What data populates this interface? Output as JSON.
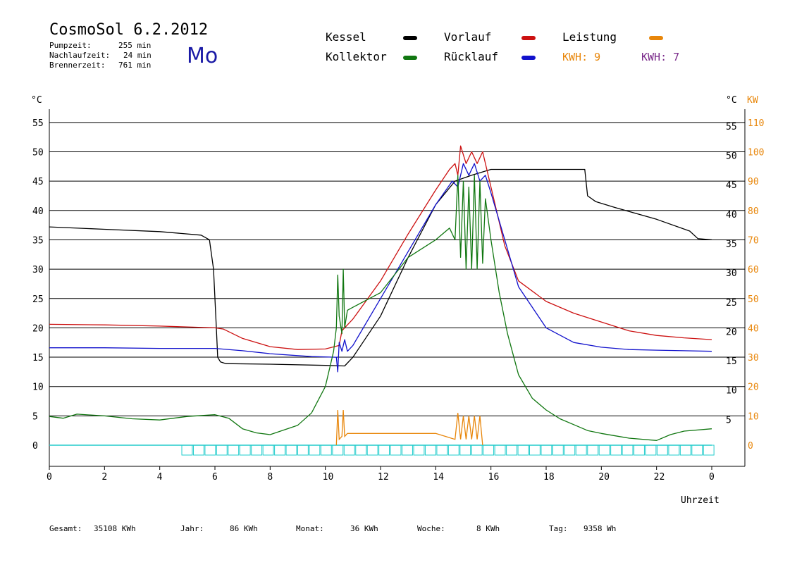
{
  "header": {
    "title": "CosmoSol 6.2.2012",
    "weekday": "Mo",
    "stats": [
      {
        "label": "Pumpzeit:",
        "value": "255 min"
      },
      {
        "label": "Nachlaufzeit:",
        "value": "24 min"
      },
      {
        "label": "Brennerzeit:",
        "value": "761 min"
      }
    ]
  },
  "legend": {
    "kessel": "Kessel",
    "kollektor": "Kollektor",
    "vorlauf": "Vorlauf",
    "ruecklauf": "Rücklauf",
    "leistung": "Leistung",
    "kwh1": "KWH: 9",
    "kwh2": "KWH: 7"
  },
  "colors": {
    "kessel": "#000000",
    "kollektor": "#117711",
    "vorlauf": "#cc1111",
    "ruecklauf": "#1111cc",
    "leistung": "#e8860a",
    "kwh2": "#7a2a8a",
    "status": "#22cccc"
  },
  "footer": {
    "gesamt_label": "Gesamt:",
    "gesamt": "35108 KWh",
    "jahr_label": "Jahr:",
    "jahr": "86 KWh",
    "monat_label": "Monat:",
    "monat": "36 KWh",
    "woche_label": "Woche:",
    "woche": "8 KWh",
    "tag_label": "Tag:",
    "tag": "9358 Wh"
  },
  "chart_data": {
    "type": "line",
    "xlabel": "Uhrzeit",
    "ylabel_left": "°C",
    "ylabel_right_1": "°C",
    "ylabel_right_2": "KW",
    "xlim": [
      0,
      24
    ],
    "ylim": [
      0,
      55
    ],
    "grid": true,
    "x_ticks": [
      "0",
      "2",
      "4",
      "6",
      "8",
      "10",
      "12",
      "14",
      "16",
      "18",
      "20",
      "22",
      "0"
    ],
    "y_ticks_left": [
      "0",
      "5",
      "10",
      "15",
      "20",
      "25",
      "30",
      "35",
      "40",
      "45",
      "50",
      "55"
    ],
    "y_ticks_right": [
      "5",
      "10",
      "15",
      "20",
      "25",
      "30",
      "35",
      "40",
      "45",
      "50",
      "55"
    ],
    "y_ticks_kw": [
      "0",
      "10",
      "20",
      "30",
      "40",
      "50",
      "60",
      "70",
      "80",
      "90",
      "100",
      "110"
    ],
    "series": [
      {
        "name": "Kessel",
        "x": [
          0,
          2,
          4,
          5.5,
          5.8,
          5.95,
          6.05,
          6.1,
          6.2,
          6.4,
          8,
          10,
          10.7,
          11,
          12,
          13,
          14,
          14.7,
          15.3,
          16,
          18,
          19.4,
          19.5,
          19.8,
          20.5,
          22,
          23.2,
          23.5,
          24
        ],
        "y": [
          37.2,
          36.8,
          36.4,
          35.8,
          35,
          30,
          20,
          15,
          14.2,
          13.9,
          13.8,
          13.6,
          13.5,
          15,
          22,
          32,
          41,
          45,
          46,
          47,
          47,
          47,
          42.5,
          41.5,
          40.5,
          38.5,
          36.5,
          35.2,
          35
        ]
      },
      {
        "name": "Vorlauf",
        "x": [
          0,
          2,
          4,
          6,
          6.3,
          7,
          8,
          9,
          10,
          10.5,
          10.6,
          10.8,
          11,
          12,
          13,
          14,
          14.5,
          14.7,
          14.8,
          14.9,
          15.1,
          15.3,
          15.5,
          15.7,
          16,
          16.5,
          17,
          18,
          19,
          20,
          21,
          22,
          23,
          24
        ],
        "y": [
          20.6,
          20.5,
          20.3,
          20,
          19.8,
          18.2,
          16.8,
          16.3,
          16.4,
          17,
          19.5,
          20.5,
          21.5,
          28,
          36,
          43.5,
          47,
          48,
          46,
          51,
          48,
          50,
          48,
          50,
          44,
          34,
          28,
          24.5,
          22.5,
          21,
          19.5,
          18.7,
          18.3,
          18
        ]
      },
      {
        "name": "Rücklauf",
        "x": [
          0,
          2,
          4,
          6,
          7,
          8,
          9.5,
          10.4,
          10.45,
          10.5,
          10.6,
          10.7,
          10.8,
          11,
          12,
          13,
          14,
          14.6,
          14.8,
          15,
          15.2,
          15.4,
          15.6,
          15.8,
          16,
          16.5,
          17,
          18,
          19,
          20,
          21,
          22,
          23,
          24
        ],
        "y": [
          16.6,
          16.6,
          16.5,
          16.5,
          16.1,
          15.6,
          15.1,
          15,
          12.5,
          17.5,
          16,
          18,
          16,
          17,
          25,
          33,
          41,
          45,
          44,
          48,
          46,
          48,
          45,
          46,
          43,
          35,
          27,
          20,
          17.5,
          16.7,
          16.3,
          16.2,
          16.1,
          16
        ]
      },
      {
        "name": "Kollektor",
        "x": [
          0,
          0.5,
          1,
          2,
          3,
          4,
          5,
          6,
          6.5,
          7,
          7.5,
          8,
          9,
          9.5,
          10,
          10.3,
          10.4,
          10.45,
          10.5,
          10.6,
          10.65,
          10.7,
          10.8,
          11,
          12,
          13,
          14,
          14.5,
          14.7,
          14.8,
          14.9,
          15.0,
          15.1,
          15.2,
          15.3,
          15.4,
          15.5,
          15.6,
          15.7,
          15.8,
          16,
          16.3,
          16.6,
          17,
          17.5,
          18,
          18.5,
          19,
          19.5,
          20,
          21,
          22,
          22.5,
          23,
          24
        ],
        "y": [
          4.9,
          4.6,
          5.3,
          5,
          4.5,
          4.3,
          4.9,
          5.2,
          4.6,
          2.8,
          2.1,
          1.8,
          3.4,
          5.5,
          10,
          16,
          20,
          29,
          22,
          19,
          30,
          20,
          23,
          23.5,
          26,
          32,
          35,
          37,
          35,
          46,
          32,
          45,
          30,
          44,
          30,
          46,
          30,
          45,
          31,
          42,
          35,
          26,
          19,
          12,
          8,
          6,
          4.5,
          3.5,
          2.5,
          2,
          1.2,
          0.8,
          1.8,
          2.4,
          2.8
        ]
      }
    ],
    "leistung_kw": {
      "x": [
        10.4,
        10.45,
        10.5,
        10.6,
        10.65,
        10.7,
        10.8,
        12,
        14,
        14.7,
        14.8,
        14.9,
        15,
        15.1,
        15.2,
        15.3,
        15.4,
        15.5,
        15.6,
        15.7
      ],
      "y": [
        0,
        6,
        1,
        1.5,
        6,
        1.5,
        2,
        2,
        2,
        1,
        5.5,
        1,
        5,
        1,
        5,
        1,
        5,
        1,
        5,
        0
      ]
    },
    "status_bar": {
      "blocks_from_h": 4.8,
      "blocks_to_h": 24
    }
  }
}
